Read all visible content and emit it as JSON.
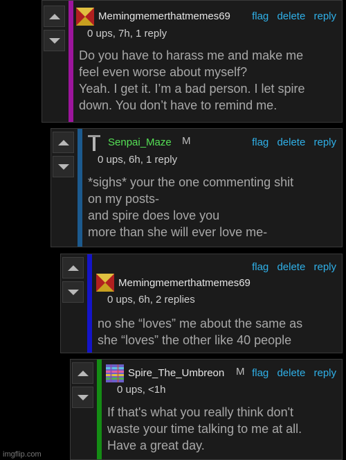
{
  "actions": {
    "flag": "flag",
    "delete": "delete",
    "reply": "reply"
  },
  "comments": [
    {
      "username": "Memingmemerthatmemes69",
      "mod_tag": "",
      "meta": "0 ups, 7h, 1 reply",
      "bar_color": "#9c159c",
      "avatar_icon": "checker-orange-avatar-icon",
      "lines": [
        "Do you have to harass me and make me",
        "feel even worse about myself?",
        "Yeah. I get it. I’m a bad person. I let spire",
        "down. You don’t have to remind me."
      ]
    },
    {
      "username": "Senpai_Maze",
      "mod_tag": "M",
      "meta": "0 ups, 6h, 1 reply",
      "bar_color": "#1c5a8e",
      "avatar_icon": "dagger-avatar-icon",
      "lines": [
        "*sighs* your the one commenting shit",
        "on my posts-",
        "and spire does love you",
        "more than she will ever love me-"
      ]
    },
    {
      "username": "Memingmemerthatmemes69",
      "mod_tag": "",
      "meta": "0 ups, 6h, 2 replies",
      "bar_color": "#1414c8",
      "avatar_icon": "checker-orange-avatar-icon",
      "lines": [
        "no she “loves” me about the same as",
        "she “loves” the other like 40 people"
      ]
    },
    {
      "username": "Spire_The_Umbreon",
      "mod_tag": "M",
      "meta": "0 ups, <1h",
      "bar_color": "#148c14",
      "avatar_icon": "pixel-rainbow-avatar-icon",
      "lines": [
        "If that's what you really think don't",
        "waste your time talking to me at all.",
        "Have a great day."
      ]
    }
  ],
  "watermark": "imgflip.com"
}
